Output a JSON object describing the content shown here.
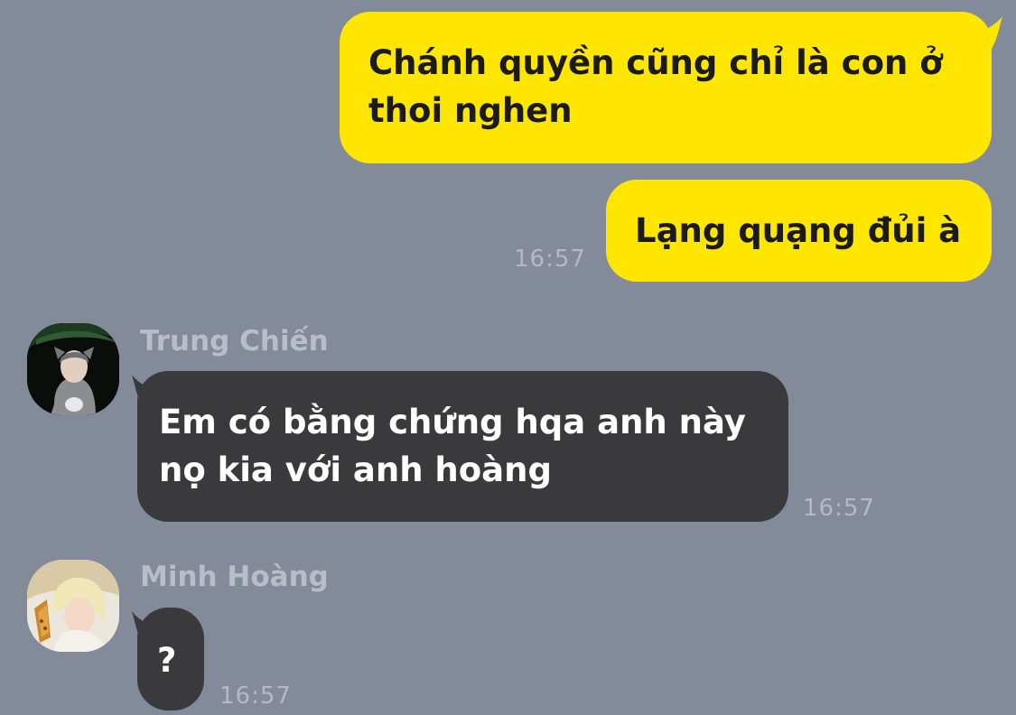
{
  "messages": [
    {
      "direction": "outgoing",
      "text_lines": [
        "Chánh quyền cũng chỉ là con ở",
        "thoi nghen"
      ]
    },
    {
      "direction": "outgoing",
      "text": "Lạng quạng đủi à",
      "time": "16:57"
    },
    {
      "direction": "incoming",
      "sender": "Trung Chiến",
      "avatar_icon": "avatar-trung-chien-photo",
      "text_lines": [
        "Em có bằng chứng hqa anh này",
        "nọ kia với anh hoàng"
      ],
      "time": "16:57"
    },
    {
      "direction": "incoming",
      "sender": "Minh Hoàng",
      "avatar_icon": "avatar-minh-hoang-photo",
      "text": "?",
      "time": "16:57"
    }
  ],
  "colors": {
    "background": "#838b9b",
    "outgoing_bubble": "#ffe600",
    "incoming_bubble": "#3a3a3c",
    "timestamp": "#b3b9c5",
    "sender_name": "#b8bdc8"
  }
}
